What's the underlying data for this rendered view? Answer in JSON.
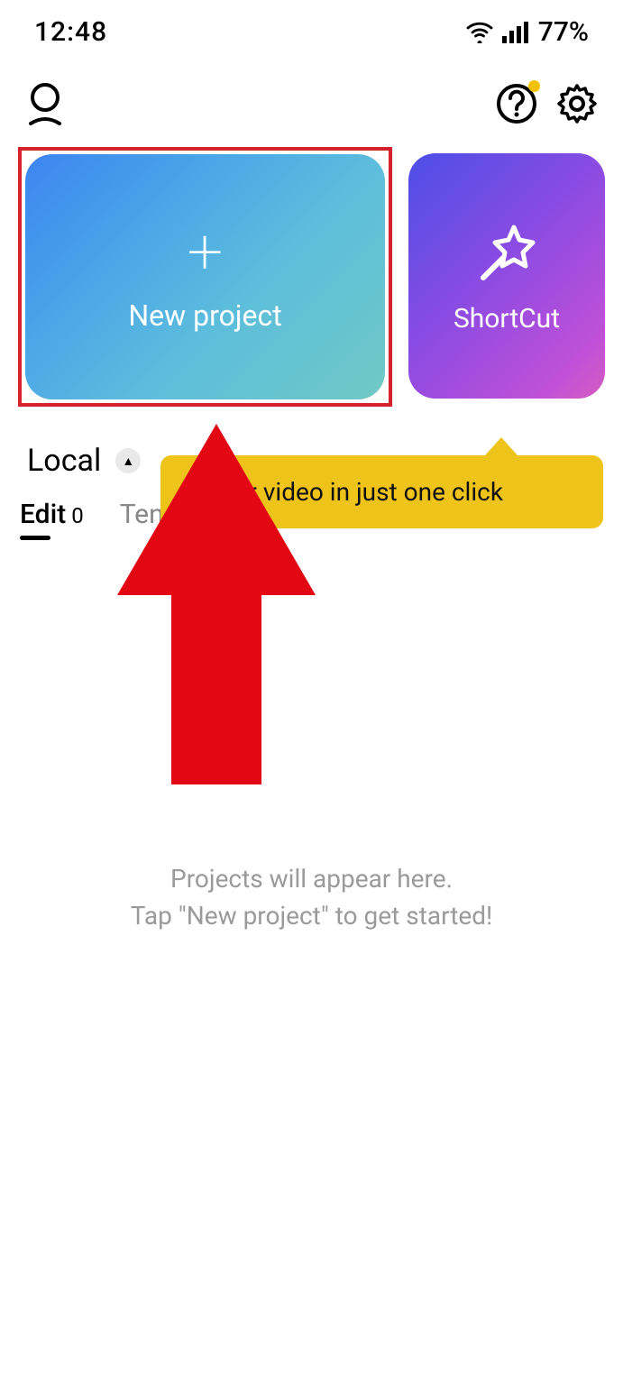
{
  "status_bar": {
    "time": "12:48",
    "battery": "77%"
  },
  "cards": {
    "new_project_label": "New project",
    "shortcut_label": "ShortCut"
  },
  "tooltip": {
    "text": "te your video in just one click"
  },
  "filter": {
    "label": "Local"
  },
  "tabs": {
    "edit_label": "Edit",
    "edit_count": "0",
    "templates_label": "Ten"
  },
  "empty_state": {
    "line1": "Projects will appear here.",
    "line2": "Tap \"New project\" to get started!"
  }
}
